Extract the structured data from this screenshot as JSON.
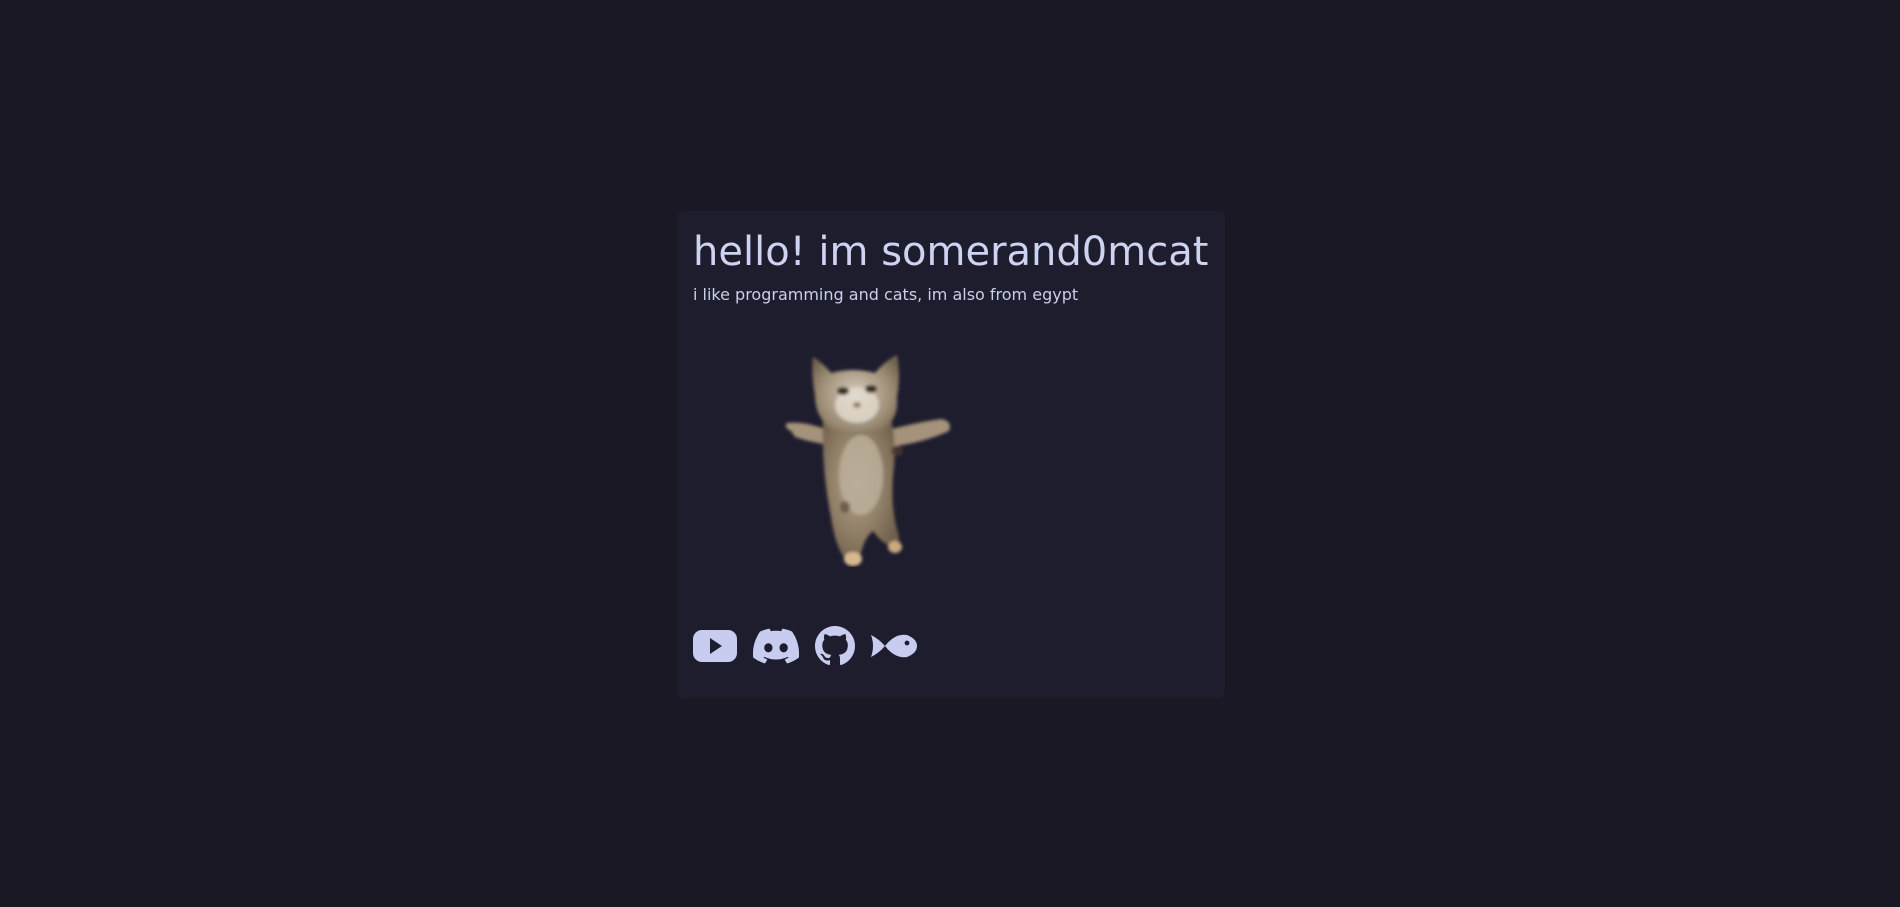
{
  "profile": {
    "title": "hello! im somerand0mcat",
    "bio": "i like programming and cats, im also from egypt"
  },
  "image": {
    "subject": "dancing cat"
  },
  "socials": [
    {
      "icon": "youtube-icon"
    },
    {
      "icon": "discord-icon"
    },
    {
      "icon": "github-icon"
    },
    {
      "icon": "fish-icon"
    }
  ],
  "colors": {
    "page_bg": "#191824",
    "card_bg": "#1e1d2e",
    "text": "#cdd3f0",
    "icon": "#c8cdf0"
  }
}
